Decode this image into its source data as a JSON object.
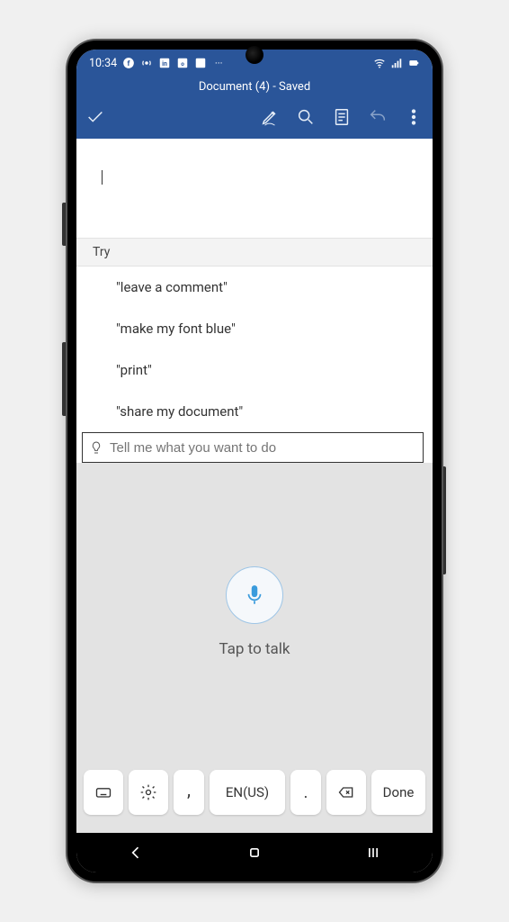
{
  "statusbar": {
    "time": "10:34",
    "icons": [
      "facebook",
      "hotspot",
      "linkedin",
      "outlook",
      "exchange",
      "more"
    ]
  },
  "titlebar": {
    "title": "Document (4) - Saved"
  },
  "toolbar": {
    "confirm": "✓",
    "items": [
      "pen",
      "search",
      "reading-view",
      "undo",
      "more"
    ]
  },
  "suggestions": {
    "header": "Try",
    "items": [
      "\"leave a comment\"",
      "\"make my font blue\"",
      "\"print\"",
      "\"share my document\""
    ]
  },
  "tellme": {
    "placeholder": "Tell me what you want to do"
  },
  "voice": {
    "hint": "Tap to talk"
  },
  "keyboard": {
    "lang": "EN(US)",
    "comma": ",",
    "dot": ".",
    "done": "Done"
  }
}
